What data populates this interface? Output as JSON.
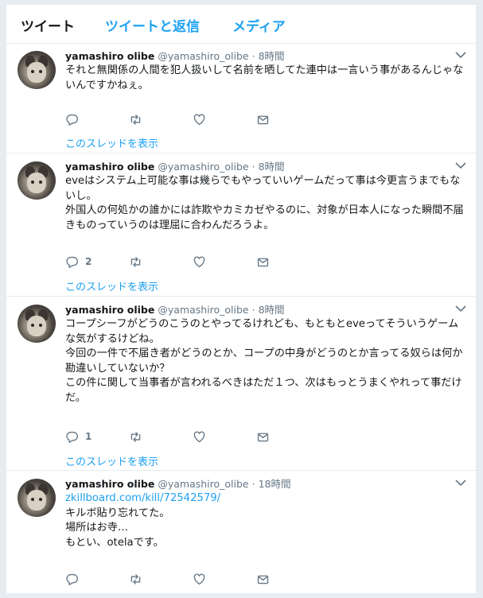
{
  "tabs": [
    "ツイート",
    "ツイートと返信",
    "メディア"
  ],
  "colors": {
    "accent": "#1da1f2",
    "text": "#14171a",
    "muted": "#657786"
  },
  "tweets": [
    {
      "name": "yamashiro olibe",
      "handle": "@yamashiro_olibe",
      "dot": "·",
      "time": "8時間",
      "link": "",
      "text": "それと無関係の人間を犯人扱いして名前を晒してた連中は一言いう事があるんじゃないんですかねぇ。",
      "reply_count": "",
      "thread_label": "このスレッドを表示"
    },
    {
      "name": "yamashiro olibe",
      "handle": "@yamashiro_olibe",
      "dot": "·",
      "time": "8時間",
      "link": "",
      "text": "eveはシステム上可能な事は幾らでもやっていいゲームだって事は今更言うまでもないし。\n外国人の何処かの誰かには詐欺やカミカゼやるのに、対象が日本人になった瞬間不届きものっていうのは理屈に合わんだろうよ。",
      "reply_count": "2",
      "thread_label": "このスレッドを表示"
    },
    {
      "name": "yamashiro olibe",
      "handle": "@yamashiro_olibe",
      "dot": "·",
      "time": "8時間",
      "link": "",
      "text": "コープシーフがどうのこうのとやってるけれども、もともとeveってそういうゲームな気がするけどね。\n今回の一件で不届き者がどうのとか、コープの中身がどうのとか言ってる奴らは何か勘違いしていないか？\nこの件に関して当事者が言われるべきはただ１つ、次はもっとうまくやれって事だけだ。",
      "reply_count": "1",
      "thread_label": "このスレッドを表示"
    },
    {
      "name": "yamashiro olibe",
      "handle": "@yamashiro_olibe",
      "dot": "·",
      "time": "18時間",
      "link": "zkillboard.com/kill/72542579/",
      "text": "キルボ貼り忘れてた。\n場所はお寺…\nもとい、otelaです。",
      "reply_count": "",
      "thread_label": ""
    }
  ]
}
